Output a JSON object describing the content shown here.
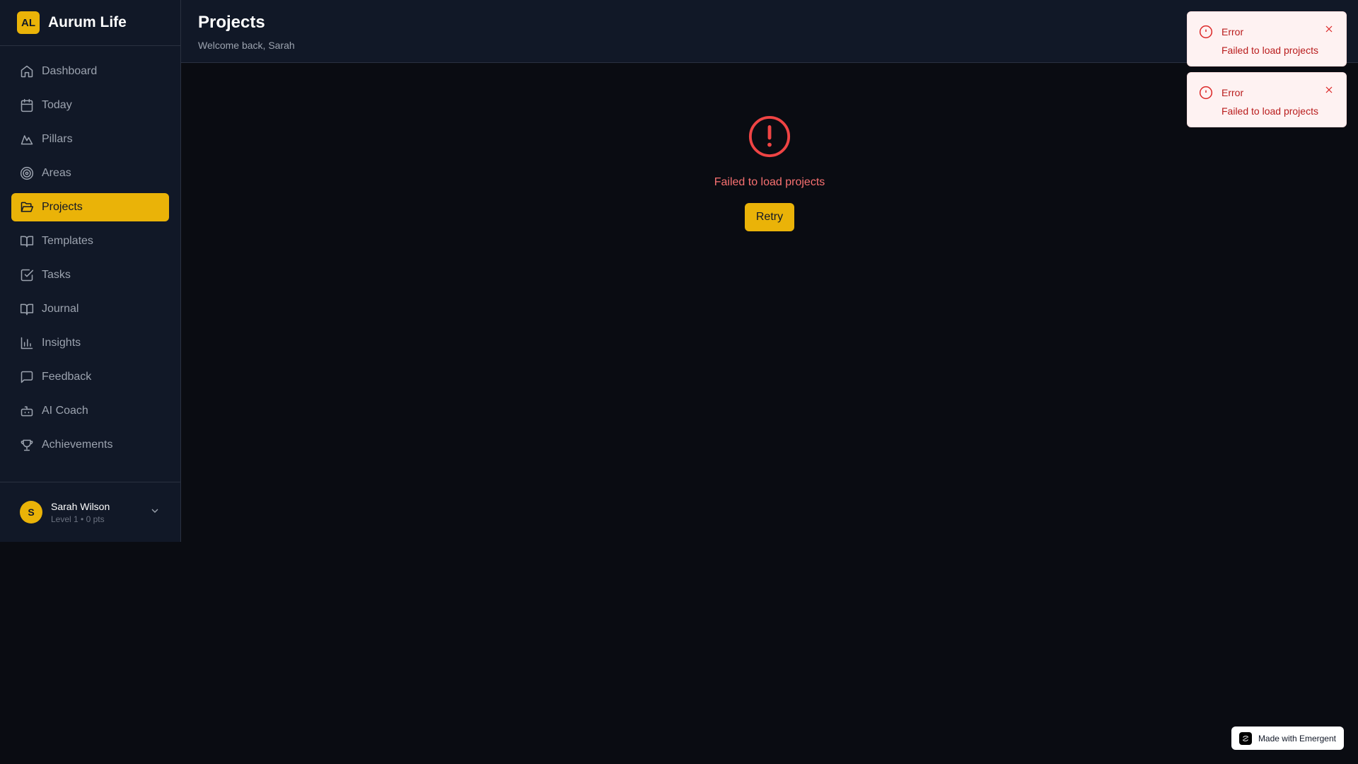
{
  "brand": {
    "logo_text": "AL",
    "name": "Aurum Life"
  },
  "sidebar": {
    "items": [
      {
        "label": "Dashboard",
        "icon": "home-icon"
      },
      {
        "label": "Today",
        "icon": "calendar-icon"
      },
      {
        "label": "Pillars",
        "icon": "mountain-icon"
      },
      {
        "label": "Areas",
        "icon": "target-icon"
      },
      {
        "label": "Projects",
        "icon": "folder-open-icon",
        "active": true
      },
      {
        "label": "Templates",
        "icon": "book-open-icon"
      },
      {
        "label": "Tasks",
        "icon": "check-square-icon"
      },
      {
        "label": "Journal",
        "icon": "book-open-icon"
      },
      {
        "label": "Insights",
        "icon": "bar-chart-icon"
      },
      {
        "label": "Feedback",
        "icon": "message-square-icon"
      },
      {
        "label": "AI Coach",
        "icon": "bot-icon"
      },
      {
        "label": "Achievements",
        "icon": "trophy-icon"
      }
    ]
  },
  "user": {
    "initial": "S",
    "name": "Sarah Wilson",
    "level": "Level 1 • 0 pts"
  },
  "header": {
    "title": "Projects",
    "subtitle": "Welcome back, Sarah"
  },
  "main": {
    "error_message": "Failed to load projects",
    "retry_label": "Retry"
  },
  "toasts": [
    {
      "title": "Error",
      "message": "Failed to load projects"
    },
    {
      "title": "Error",
      "message": "Failed to load projects"
    }
  ],
  "badge": {
    "label": "Made with Emergent"
  },
  "colors": {
    "accent": "#eab308",
    "background": "#0a0c12",
    "sidebar": "#111827",
    "error": "#ef4444",
    "toast_bg": "#fef2f2"
  }
}
